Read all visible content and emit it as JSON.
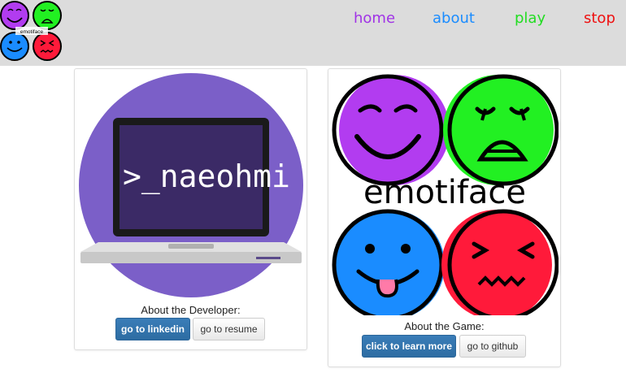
{
  "header": {
    "logo_text": "emotiface",
    "nav": [
      {
        "label": "home",
        "color": "#a033e6"
      },
      {
        "label": "about",
        "color": "#1a8cff"
      },
      {
        "label": "play",
        "color": "#22dd22"
      },
      {
        "label": "stop",
        "color": "#ee1111"
      }
    ]
  },
  "developer": {
    "logo_text": ">_naeohmi",
    "caption": "About the Developer:",
    "linkedin_label": "go to linkedin",
    "resume_label": "go to resume"
  },
  "game": {
    "logo_text": "emotiface",
    "caption": "About the Game:",
    "learn_label": "click to learn more",
    "github_label": "go to github"
  },
  "colors": {
    "purple_face": "#b23cf0",
    "green_face": "#22f022",
    "blue_face": "#1a8cff",
    "red_face": "#ff1a3a",
    "dev_circle": "#7b5fc8",
    "laptop_screen": "#3b2a66",
    "navbar_bg": "#dcdcdc"
  }
}
